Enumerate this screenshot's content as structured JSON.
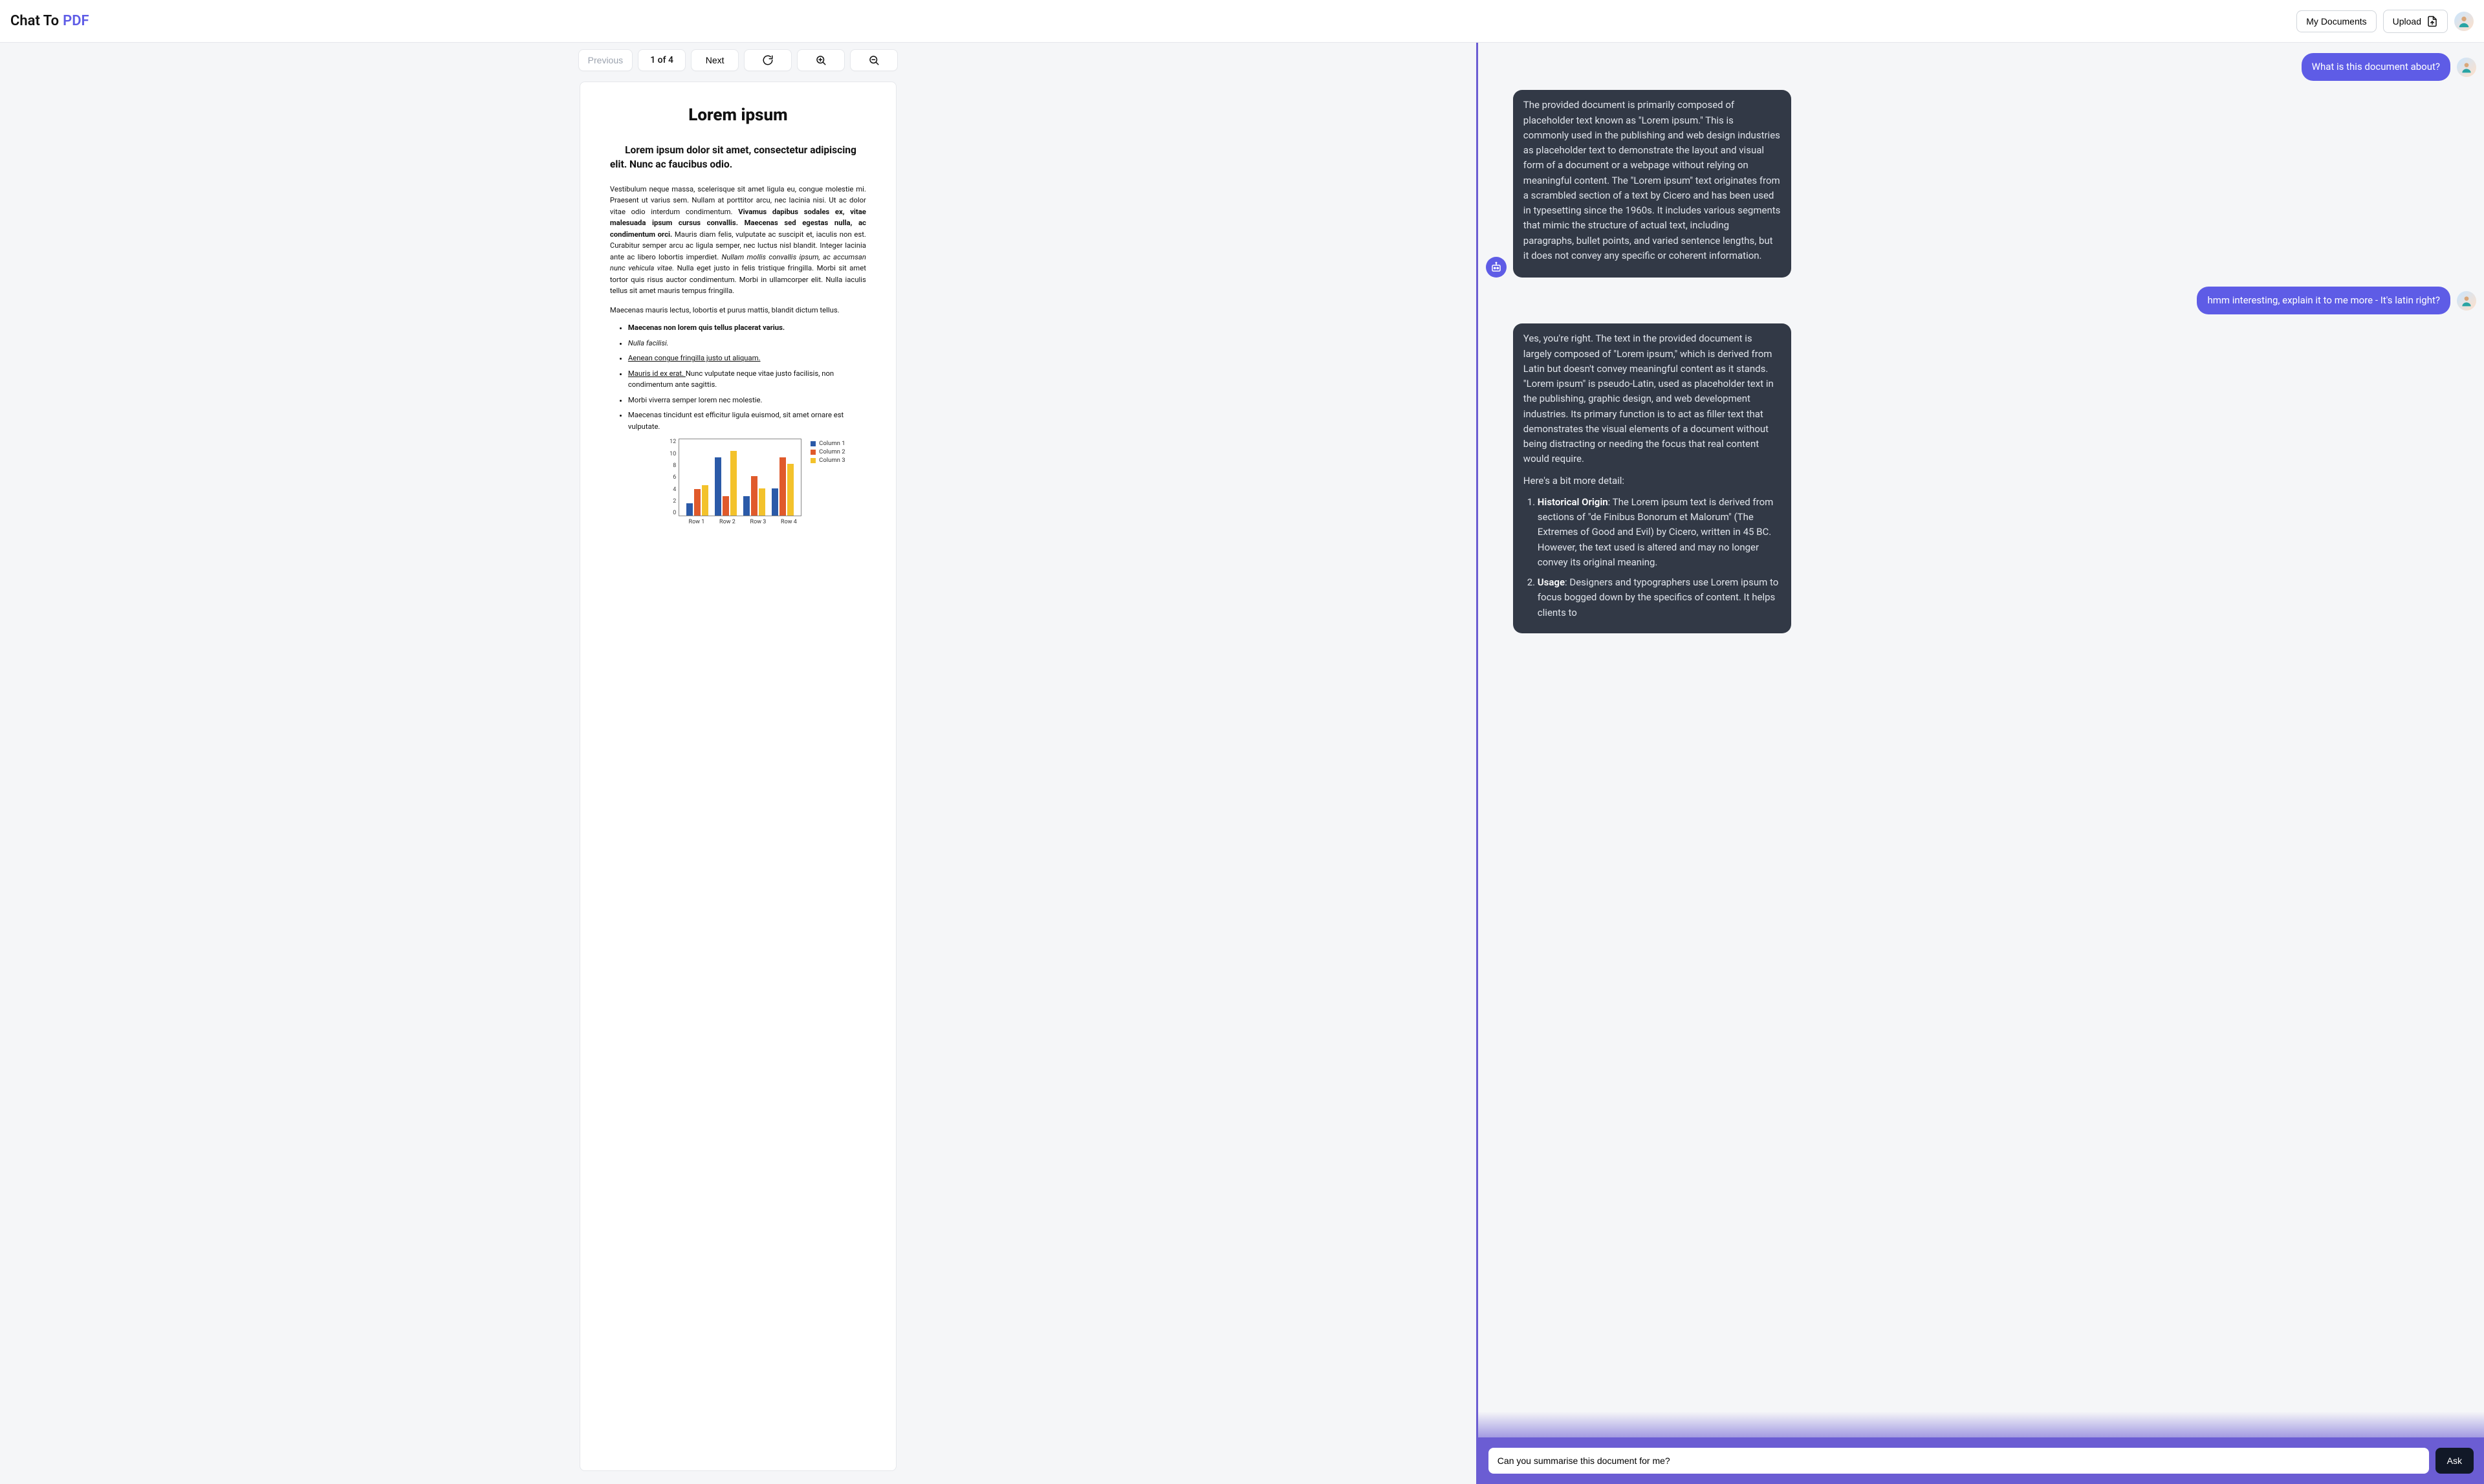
{
  "brand": {
    "part1": "Chat To",
    "part2": "PDF"
  },
  "header": {
    "my_documents": "My Documents",
    "upload": "Upload"
  },
  "toolbar": {
    "previous": "Previous",
    "page_indicator": "1 of 4",
    "next": "Next"
  },
  "document": {
    "title": "Lorem ipsum",
    "heading": "Lorem ipsum dolor sit amet, consectetur adipiscing elit. Nunc ac faucibus odio.",
    "para1_a": "Vestibulum neque massa, scelerisque sit amet ligula eu, congue molestie mi. Praesent ut varius sem. Nullam at porttitor arcu, nec lacinia nisi. Ut ac dolor vitae odio interdum condimentum. ",
    "para1_b": "Vivamus dapibus sodales ex, vitae malesuada ipsum cursus convallis. Maecenas sed egestas nulla, ac condimentum orci.",
    "para1_c": " Mauris diam felis, vulputate ac suscipit et, iaculis non est. Curabitur semper arcu ac ligula semper, nec luctus nisl blandit. Integer lacinia ante ac libero lobortis imperdiet. ",
    "para1_d": "Nullam mollis convallis ipsum, ac accumsan nunc vehicula vitae.",
    "para1_e": " Nulla eget justo in felis tristique fringilla. Morbi sit amet tortor quis risus auctor condimentum. Morbi in ullamcorper elit. Nulla iaculis tellus sit amet mauris tempus fringilla.",
    "para2": "Maecenas mauris lectus, lobortis et purus mattis, blandit dictum tellus.",
    "bullets": {
      "b1": "Maecenas non lorem quis tellus placerat varius.",
      "b2": "Nulla facilisi.",
      "b3": "Aenean congue fringilla justo ut aliquam. ",
      "b4a": "Mauris id ex erat. ",
      "b4b": "Nunc vulputate neque vitae justo facilisis, non condimentum ante sagittis.",
      "b5": "Morbi viverra semper lorem nec molestie.",
      "b6": "Maecenas tincidunt est efficitur ligula euismod, sit amet ornare est vulputate."
    }
  },
  "chart_data": {
    "type": "bar",
    "categories": [
      "Row 1",
      "Row 2",
      "Row 3",
      "Row 4"
    ],
    "series": [
      {
        "name": "Column 1",
        "color": "#2b5aa8",
        "values": [
          2,
          9.2,
          3.1,
          4.3
        ]
      },
      {
        "name": "Column 2",
        "color": "#e05a2b",
        "values": [
          4.2,
          3.1,
          6.2,
          9.2
        ]
      },
      {
        "name": "Column 3",
        "color": "#f3c22b",
        "values": [
          4.8,
          10.2,
          4.3,
          8.2
        ]
      }
    ],
    "ylim": [
      0,
      12
    ],
    "yticks": [
      0,
      2,
      4,
      6,
      8,
      10,
      12
    ],
    "legend": [
      "Column 1",
      "Column 2",
      "Column 3"
    ]
  },
  "chat": {
    "user1": "What is this document about?",
    "bot1": "The provided document is primarily composed of placeholder text known as \"Lorem ipsum.\" This is commonly used in the publishing and web design industries as placeholder text to demonstrate the layout and visual form of a document or a webpage without relying on meaningful content. The \"Lorem ipsum\" text originates from a scrambled section of a text by Cicero and has been used in typesetting since the 1960s. It includes various segments that mimic the structure of actual text, including paragraphs, bullet points, and varied sentence lengths, but it does not convey any specific or coherent information.",
    "user2": "hmm interesting, explain it to me more - It's latin right?",
    "bot2_p1": "Yes, you're right. The text in the provided document is largely composed of \"Lorem ipsum,\" which is derived from Latin but doesn't convey meaningful content as it stands. \"Lorem ipsum\" is pseudo-Latin, used as placeholder text in the publishing, graphic design, and web development industries. Its primary function is to act as filler text that demonstrates the visual elements of a document without being distracting or needing the focus that real content would require.",
    "bot2_p2": "Here's a bit more detail:",
    "bot2_li1_label": "Historical Origin",
    "bot2_li1_body": ": The Lorem ipsum text is derived from sections of \"de Finibus Bonorum et Malorum\" (The Extremes of Good and Evil) by Cicero, written in 45 BC. However, the text used is altered and may no longer convey its original meaning.",
    "bot2_li2_label": "Usage",
    "bot2_li2_body": ": Designers and typographers use Lorem ipsum to focus bogged down by the specifics of content. It helps clients to"
  },
  "input": {
    "value": "Can you summarise this document for me?",
    "ask": "Ask"
  }
}
